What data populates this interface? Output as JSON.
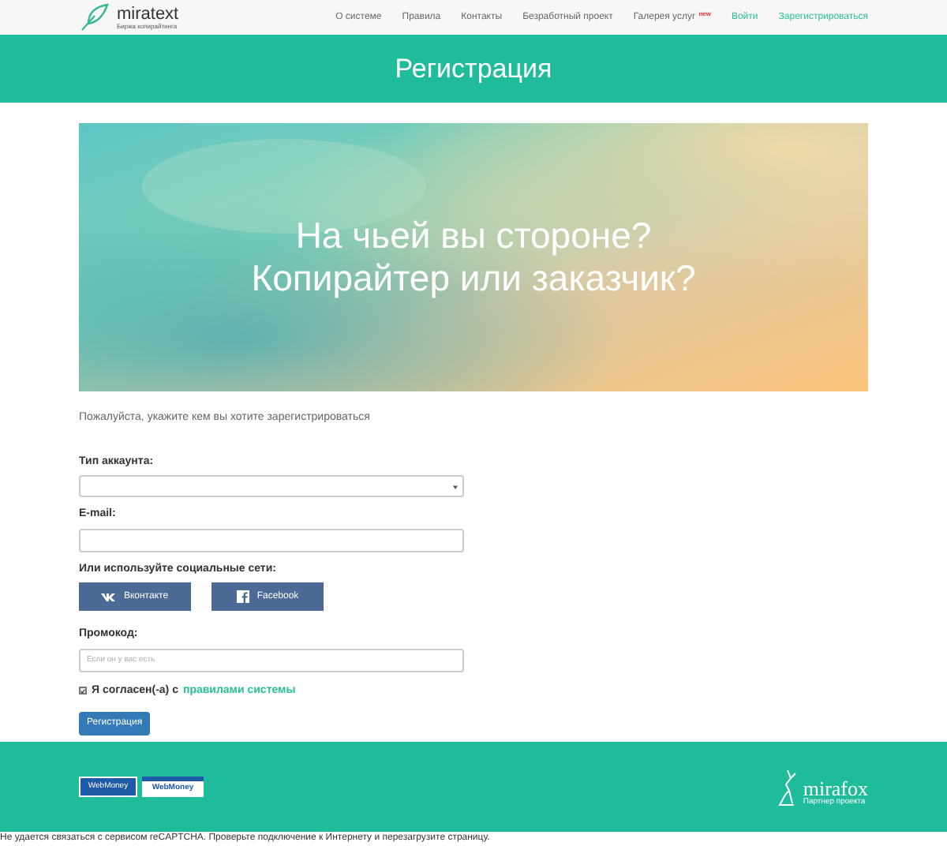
{
  "logo": {
    "name": "miratext",
    "tagline": "Биржа копирайтинга"
  },
  "nav": [
    {
      "label": "О системе",
      "kind": "plain"
    },
    {
      "label": "Правила",
      "kind": "plain"
    },
    {
      "label": "Контакты",
      "kind": "plain"
    },
    {
      "label": "Безработный проект",
      "kind": "plain"
    },
    {
      "label": "Галерея услуг",
      "kind": "plain",
      "badge": "new"
    },
    {
      "label": "Войти",
      "kind": "accent"
    },
    {
      "label": "Зарегистрироваться",
      "kind": "accent"
    }
  ],
  "page_title": "Регистрация",
  "banner": {
    "line1": "На чьей вы стороне?",
    "line2": "Копирайтер или заказчик?"
  },
  "intro": "Пожалуйста, укажите кем вы хотите зарегистрироваться",
  "account_type": {
    "label": "Тип аккаунта:"
  },
  "email": {
    "label": "E-mail:"
  },
  "social": {
    "label": "Или используйте социальные сети:",
    "buttons": [
      {
        "label": "Вконтакте",
        "kind": "vk"
      },
      {
        "label": "Facebook",
        "kind": "fb"
      }
    ]
  },
  "promo": {
    "label": "Промокод:",
    "placeholder": "Если он у вас есть"
  },
  "agree": {
    "checked": true,
    "text": "Я согласен(-а) с",
    "link": "правилами системы"
  },
  "submit": "Регистрация",
  "footer": {
    "badges": [
      "WebMoney",
      "WebMoney"
    ],
    "partner": {
      "name": "mirafox",
      "tagline": "Партнер проекта"
    }
  },
  "error": "Не удается связаться с сервисом reCAPTCHA. Проверьте подключение к Интернету и перезагрузите страницу."
}
